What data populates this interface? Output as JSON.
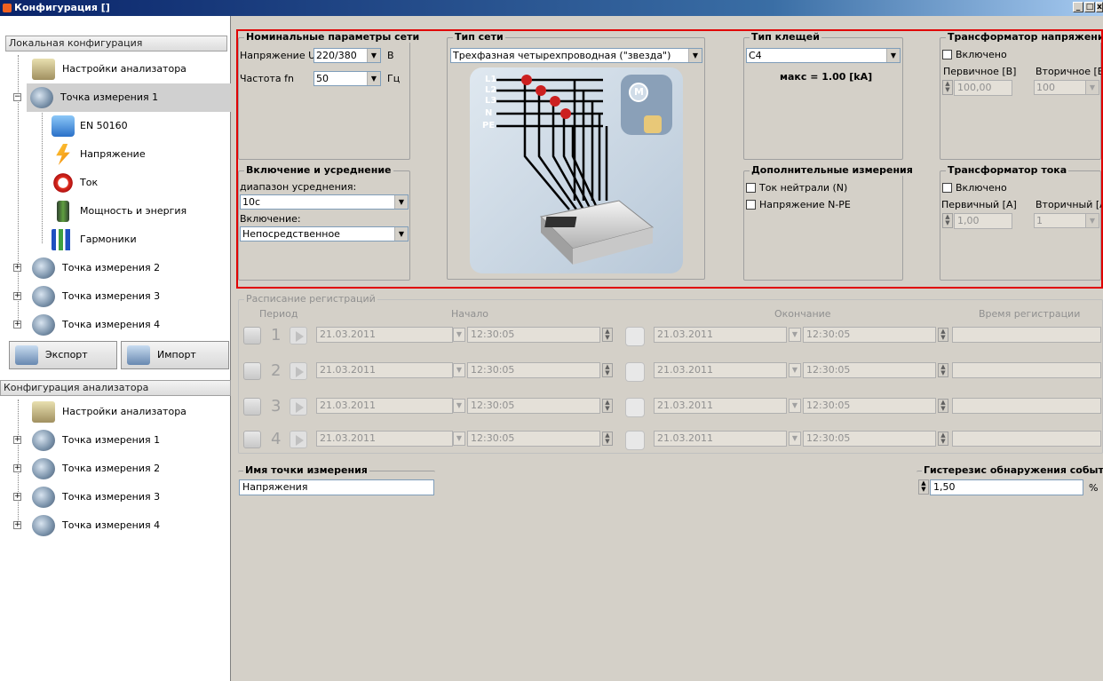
{
  "window": {
    "title": "Конфигурация []"
  },
  "left": {
    "local_header": "Локальная конфигурация",
    "local_tree": [
      {
        "label": "Настройки анализатора",
        "icon": "analyzer-settings-icon"
      },
      {
        "label": "Точка измерения 1",
        "icon": "measurement-point-icon"
      },
      {
        "label": "EN 50160",
        "icon": "en50160-icon"
      },
      {
        "label": "Напряжение",
        "icon": "voltage-icon"
      },
      {
        "label": "Ток",
        "icon": "current-clamp-icon"
      },
      {
        "label": "Мощность и энергия",
        "icon": "power-energy-icon"
      },
      {
        "label": "Гармоники",
        "icon": "harmonics-icon"
      },
      {
        "label": "Точка измерения 2",
        "icon": "measurement-point-icon"
      },
      {
        "label": "Точка измерения 3",
        "icon": "measurement-point-icon"
      },
      {
        "label": "Точка измерения 4",
        "icon": "measurement-point-icon"
      }
    ],
    "export_label": "Экспорт",
    "import_label": "Импорт",
    "analyzer_header": "Конфигурация анализатора",
    "analyzer_tree": [
      {
        "label": "Настройки анализатора"
      },
      {
        "label": "Точка измерения 1"
      },
      {
        "label": "Точка измерения 2"
      },
      {
        "label": "Точка измерения 3"
      },
      {
        "label": "Точка измерения 4"
      }
    ]
  },
  "nominal": {
    "title": "Номинальные параметры сети",
    "voltage_label": "Напряжение Un",
    "voltage_value": "220/380",
    "voltage_unit": "В",
    "freq_label": "Частота fn",
    "freq_value": "50",
    "freq_unit": "Гц"
  },
  "net_type": {
    "title": "Тип сети",
    "value": "Трехфазная четырехпроводная (\"звезда\")",
    "lines": [
      "L1",
      "L2",
      "L3",
      "N",
      "PE"
    ],
    "motor_label": "M"
  },
  "clamp": {
    "title": "Тип клещей",
    "value": "C4",
    "max_text": "макс = 1.00 [kA]"
  },
  "vt": {
    "title": "Трансформатор напряжения",
    "enabled_label": "Включено",
    "primary_label": "Первичное [В]",
    "secondary_label": "Вторичное [В]",
    "primary_value": "100,00",
    "secondary_value": "100"
  },
  "averaging": {
    "title": "Включение и усреднение",
    "range_label": "диапазон усреднения:",
    "range_value": "10с",
    "conn_label": "Включение:",
    "conn_value": "Непосредственное"
  },
  "extra": {
    "title": "Дополнительные измерения",
    "neutral_label": "Ток нейтрали (N)",
    "npe_label": "Напряжение N-PE"
  },
  "ct": {
    "title": "Трансформатор тока",
    "enabled_label": "Включено",
    "primary_label": "Первичный [A]",
    "secondary_label": "Вторичный [A]",
    "primary_value": "1,00",
    "secondary_value": "1"
  },
  "schedule": {
    "title": "Расписание регистраций",
    "col_period": "Период",
    "col_start": "Начало",
    "col_end": "Окончание",
    "col_time": "Время регистрации",
    "rows": [
      {
        "n": "1",
        "start_date": "21.03.2011",
        "start_time": "12:30:05",
        "end_date": "21.03.2011",
        "end_time": "12:30:05"
      },
      {
        "n": "2",
        "start_date": "21.03.2011",
        "start_time": "12:30:05",
        "end_date": "21.03.2011",
        "end_time": "12:30:05"
      },
      {
        "n": "3",
        "start_date": "21.03.2011",
        "start_time": "12:30:05",
        "end_date": "21.03.2011",
        "end_time": "12:30:05"
      },
      {
        "n": "4",
        "start_date": "21.03.2011",
        "start_time": "12:30:05",
        "end_date": "21.03.2011",
        "end_time": "12:30:05"
      }
    ]
  },
  "point_name": {
    "title": "Имя точки измерения",
    "value": "Напряжения"
  },
  "hysteresis": {
    "title": "Гистерезис обнаружения событий",
    "value": "1,50",
    "unit": "%"
  }
}
